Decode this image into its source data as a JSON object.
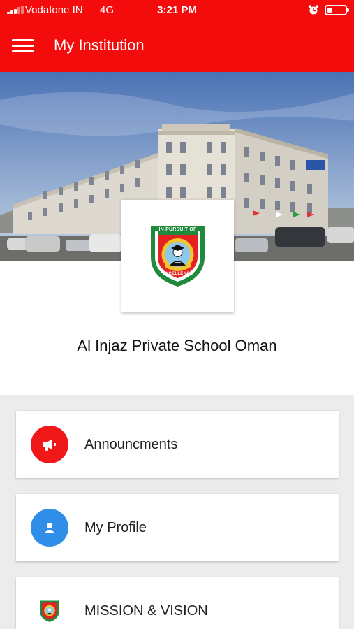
{
  "status_bar": {
    "carrier": "Vodafone IN",
    "network": "4G",
    "time": "3:21 PM",
    "signal_bars_active": 3,
    "signal_bars_total": 5,
    "battery_level": 0.25
  },
  "app_bar": {
    "title": "My Institution",
    "menu_icon": "hamburger-menu-icon",
    "background": "#f40b0b"
  },
  "institution": {
    "name": "Al Injaz Private School Oman",
    "logo_motto_top": "IN PURSUIT OF",
    "logo_motto_bottom": "EXCELLENCE"
  },
  "menu_items": [
    {
      "label": "Announcments",
      "icon": "megaphone-icon",
      "color": "#f01818"
    },
    {
      "label": "My Profile",
      "icon": "person-icon",
      "color": "#2f8fe8"
    },
    {
      "label": "MISSION & VISION",
      "icon": "school-crest-icon",
      "color": "#ffffff"
    }
  ]
}
